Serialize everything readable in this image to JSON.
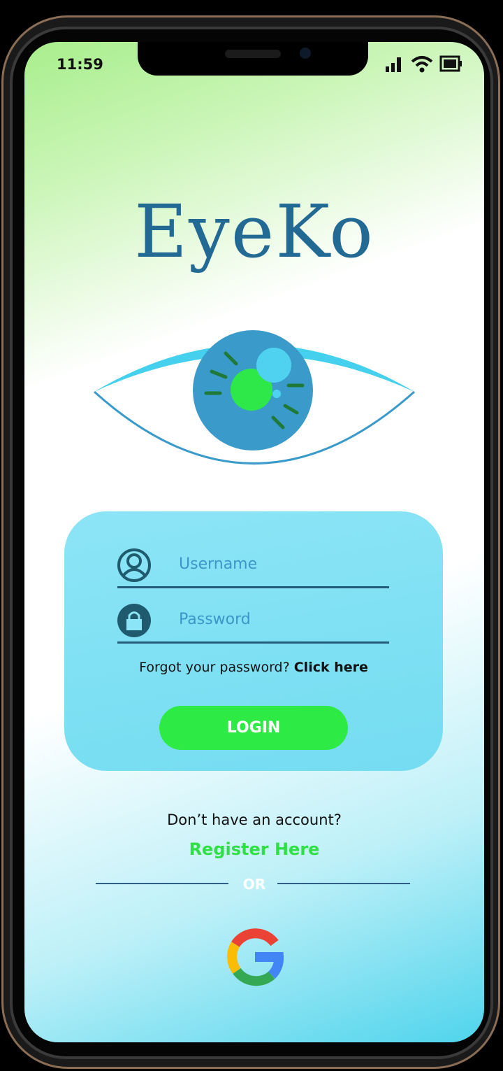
{
  "status_bar": {
    "time": "11:59"
  },
  "app": {
    "logo_text": "EyeKo"
  },
  "login_form": {
    "username_placeholder": "Username",
    "password_placeholder": "Password",
    "forgot_text": "Forgot your password?",
    "forgot_link": "Click here",
    "login_label": "LOGIN"
  },
  "signup": {
    "prompt": "Don’t have an account?",
    "register_link": "Register Here",
    "divider_text": "OR"
  },
  "colors": {
    "brand": "#226a93",
    "accent_green": "#2eea45",
    "card": "#8ce5f6",
    "iris": "#3a9ac9"
  },
  "icons": [
    "signal-icon",
    "wifi-icon",
    "battery-icon",
    "user-icon",
    "lock-icon",
    "google-icon"
  ]
}
